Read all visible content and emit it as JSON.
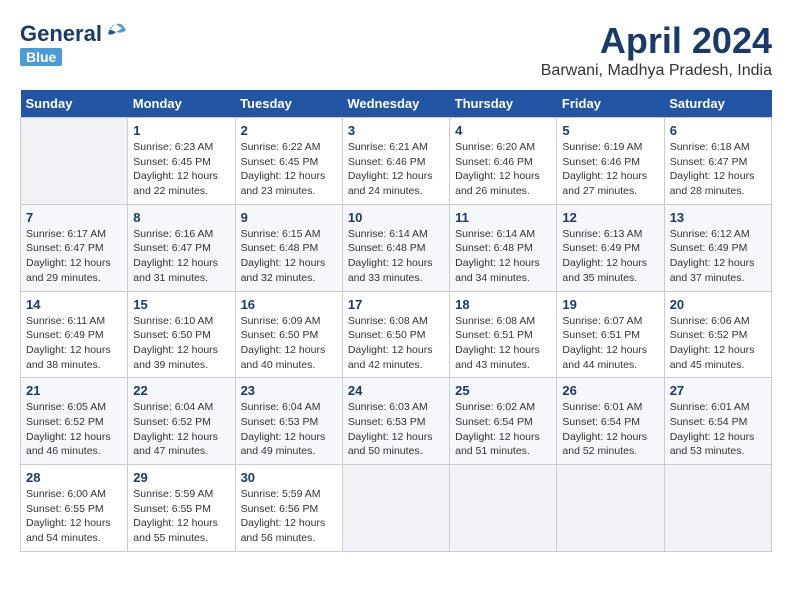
{
  "header": {
    "logo_general": "General",
    "logo_blue": "Blue",
    "title": "April 2024",
    "subtitle": "Barwani, Madhya Pradesh, India"
  },
  "weekdays": [
    "Sunday",
    "Monday",
    "Tuesday",
    "Wednesday",
    "Thursday",
    "Friday",
    "Saturday"
  ],
  "weeks": [
    [
      {
        "day": "",
        "info": ""
      },
      {
        "day": "1",
        "info": "Sunrise: 6:23 AM\nSunset: 6:45 PM\nDaylight: 12 hours\nand 22 minutes."
      },
      {
        "day": "2",
        "info": "Sunrise: 6:22 AM\nSunset: 6:45 PM\nDaylight: 12 hours\nand 23 minutes."
      },
      {
        "day": "3",
        "info": "Sunrise: 6:21 AM\nSunset: 6:46 PM\nDaylight: 12 hours\nand 24 minutes."
      },
      {
        "day": "4",
        "info": "Sunrise: 6:20 AM\nSunset: 6:46 PM\nDaylight: 12 hours\nand 26 minutes."
      },
      {
        "day": "5",
        "info": "Sunrise: 6:19 AM\nSunset: 6:46 PM\nDaylight: 12 hours\nand 27 minutes."
      },
      {
        "day": "6",
        "info": "Sunrise: 6:18 AM\nSunset: 6:47 PM\nDaylight: 12 hours\nand 28 minutes."
      }
    ],
    [
      {
        "day": "7",
        "info": "Sunrise: 6:17 AM\nSunset: 6:47 PM\nDaylight: 12 hours\nand 29 minutes."
      },
      {
        "day": "8",
        "info": "Sunrise: 6:16 AM\nSunset: 6:47 PM\nDaylight: 12 hours\nand 31 minutes."
      },
      {
        "day": "9",
        "info": "Sunrise: 6:15 AM\nSunset: 6:48 PM\nDaylight: 12 hours\nand 32 minutes."
      },
      {
        "day": "10",
        "info": "Sunrise: 6:14 AM\nSunset: 6:48 PM\nDaylight: 12 hours\nand 33 minutes."
      },
      {
        "day": "11",
        "info": "Sunrise: 6:14 AM\nSunset: 6:48 PM\nDaylight: 12 hours\nand 34 minutes."
      },
      {
        "day": "12",
        "info": "Sunrise: 6:13 AM\nSunset: 6:49 PM\nDaylight: 12 hours\nand 35 minutes."
      },
      {
        "day": "13",
        "info": "Sunrise: 6:12 AM\nSunset: 6:49 PM\nDaylight: 12 hours\nand 37 minutes."
      }
    ],
    [
      {
        "day": "14",
        "info": "Sunrise: 6:11 AM\nSunset: 6:49 PM\nDaylight: 12 hours\nand 38 minutes."
      },
      {
        "day": "15",
        "info": "Sunrise: 6:10 AM\nSunset: 6:50 PM\nDaylight: 12 hours\nand 39 minutes."
      },
      {
        "day": "16",
        "info": "Sunrise: 6:09 AM\nSunset: 6:50 PM\nDaylight: 12 hours\nand 40 minutes."
      },
      {
        "day": "17",
        "info": "Sunrise: 6:08 AM\nSunset: 6:50 PM\nDaylight: 12 hours\nand 42 minutes."
      },
      {
        "day": "18",
        "info": "Sunrise: 6:08 AM\nSunset: 6:51 PM\nDaylight: 12 hours\nand 43 minutes."
      },
      {
        "day": "19",
        "info": "Sunrise: 6:07 AM\nSunset: 6:51 PM\nDaylight: 12 hours\nand 44 minutes."
      },
      {
        "day": "20",
        "info": "Sunrise: 6:06 AM\nSunset: 6:52 PM\nDaylight: 12 hours\nand 45 minutes."
      }
    ],
    [
      {
        "day": "21",
        "info": "Sunrise: 6:05 AM\nSunset: 6:52 PM\nDaylight: 12 hours\nand 46 minutes."
      },
      {
        "day": "22",
        "info": "Sunrise: 6:04 AM\nSunset: 6:52 PM\nDaylight: 12 hours\nand 47 minutes."
      },
      {
        "day": "23",
        "info": "Sunrise: 6:04 AM\nSunset: 6:53 PM\nDaylight: 12 hours\nand 49 minutes."
      },
      {
        "day": "24",
        "info": "Sunrise: 6:03 AM\nSunset: 6:53 PM\nDaylight: 12 hours\nand 50 minutes."
      },
      {
        "day": "25",
        "info": "Sunrise: 6:02 AM\nSunset: 6:54 PM\nDaylight: 12 hours\nand 51 minutes."
      },
      {
        "day": "26",
        "info": "Sunrise: 6:01 AM\nSunset: 6:54 PM\nDaylight: 12 hours\nand 52 minutes."
      },
      {
        "day": "27",
        "info": "Sunrise: 6:01 AM\nSunset: 6:54 PM\nDaylight: 12 hours\nand 53 minutes."
      }
    ],
    [
      {
        "day": "28",
        "info": "Sunrise: 6:00 AM\nSunset: 6:55 PM\nDaylight: 12 hours\nand 54 minutes."
      },
      {
        "day": "29",
        "info": "Sunrise: 5:59 AM\nSunset: 6:55 PM\nDaylight: 12 hours\nand 55 minutes."
      },
      {
        "day": "30",
        "info": "Sunrise: 5:59 AM\nSunset: 6:56 PM\nDaylight: 12 hours\nand 56 minutes."
      },
      {
        "day": "",
        "info": ""
      },
      {
        "day": "",
        "info": ""
      },
      {
        "day": "",
        "info": ""
      },
      {
        "day": "",
        "info": ""
      }
    ]
  ]
}
